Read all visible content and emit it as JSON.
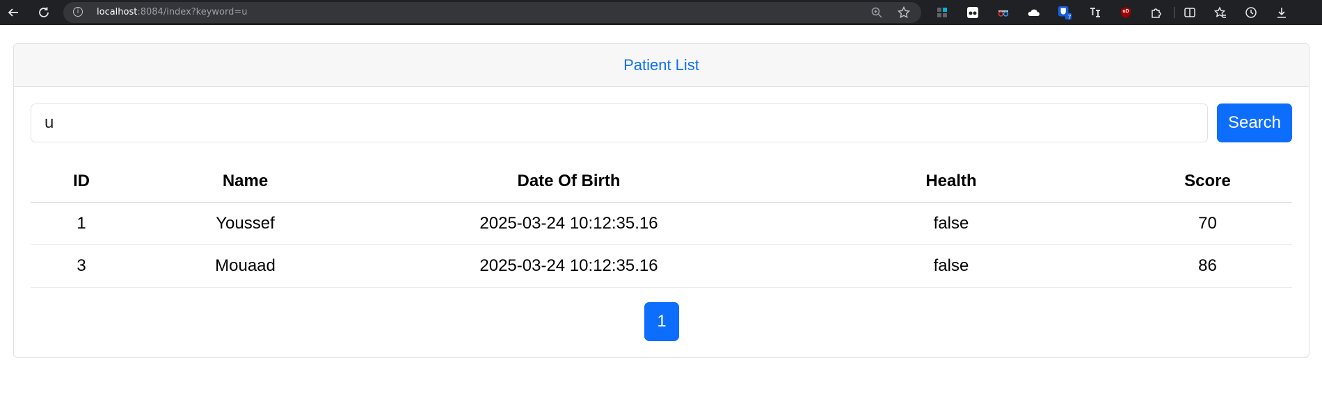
{
  "browser": {
    "url_host": "localhost",
    "url_rest": ":8084/index?keyword=u",
    "ext_badge_count": "7",
    "ext_ub_label": "uD"
  },
  "page": {
    "title": "Patient List",
    "search": {
      "value": "u",
      "button_label": "Search"
    },
    "table": {
      "headers": [
        "ID",
        "Name",
        "Date Of Birth",
        "Health",
        "Score"
      ],
      "rows": [
        [
          "1",
          "Youssef",
          "2025-03-24 10:12:35.16",
          "false",
          "70"
        ],
        [
          "3",
          "Mouaad",
          "2025-03-24 10:12:35.16",
          "false",
          "86"
        ]
      ]
    },
    "pagination": {
      "pages": [
        "1"
      ],
      "active": "1"
    }
  },
  "colors": {
    "accent": "#0d6efd",
    "chrome": "#202124",
    "header_bg": "#f7f7f7",
    "border": "#dee2e6"
  }
}
